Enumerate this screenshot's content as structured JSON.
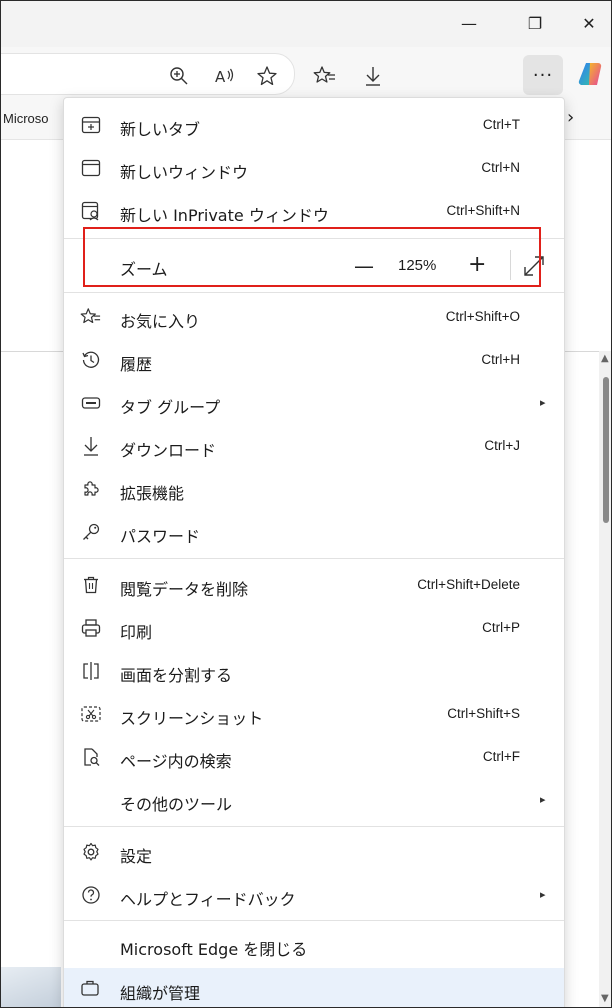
{
  "window": {
    "minimize": "—",
    "maximize": "❐",
    "close": "✕"
  },
  "toolbar": {
    "more_label": "···"
  },
  "favorites_bar": {
    "item": "Microso",
    "chevron": "›"
  },
  "menu": {
    "items_top": [
      {
        "icon": "new-tab-icon",
        "label": "新しいタブ",
        "shortcut": "Ctrl+T"
      },
      {
        "icon": "new-window-icon",
        "label": "新しいウィンドウ",
        "shortcut": "Ctrl+N"
      },
      {
        "icon": "inprivate-icon",
        "label": "新しい InPrivate ウィンドウ",
        "shortcut": "Ctrl+Shift+N"
      }
    ],
    "zoom": {
      "label": "ズーム",
      "minus": "—",
      "value": "125%",
      "plus": "+"
    },
    "items_mid": [
      {
        "icon": "favorites-icon",
        "label": "お気に入り",
        "shortcut": "Ctrl+Shift+O"
      },
      {
        "icon": "history-icon",
        "label": "履歴",
        "shortcut": "Ctrl+H"
      },
      {
        "icon": "tab-group-icon",
        "label": "タブ グループ",
        "shortcut": "",
        "submenu": "▸"
      },
      {
        "icon": "download-icon",
        "label": "ダウンロード",
        "shortcut": "Ctrl+J"
      },
      {
        "icon": "extensions-icon",
        "label": "拡張機能",
        "shortcut": ""
      },
      {
        "icon": "password-icon",
        "label": "パスワード",
        "shortcut": ""
      }
    ],
    "items_tools": [
      {
        "icon": "trash-icon",
        "label": "閲覧データを削除",
        "shortcut": "Ctrl+Shift+Delete"
      },
      {
        "icon": "print-icon",
        "label": "印刷",
        "shortcut": "Ctrl+P"
      },
      {
        "icon": "split-screen-icon",
        "label": "画面を分割する",
        "shortcut": ""
      },
      {
        "icon": "screenshot-icon",
        "label": "スクリーンショット",
        "shortcut": "Ctrl+Shift+S"
      },
      {
        "icon": "find-in-page-icon",
        "label": "ページ内の検索",
        "shortcut": "Ctrl+F"
      },
      {
        "icon": "",
        "label": "その他のツール",
        "shortcut": "",
        "submenu": "▸"
      }
    ],
    "items_settings": [
      {
        "icon": "gear-icon",
        "label": "設定",
        "shortcut": ""
      },
      {
        "icon": "help-icon",
        "label": "ヘルプとフィードバック",
        "shortcut": "",
        "submenu": "▸"
      }
    ],
    "close_label": "Microsoft Edge を閉じる",
    "managed_label": "組織が管理"
  },
  "colors": {
    "highlight": "#e0201a",
    "managed_bg": "#e9f1fb"
  }
}
